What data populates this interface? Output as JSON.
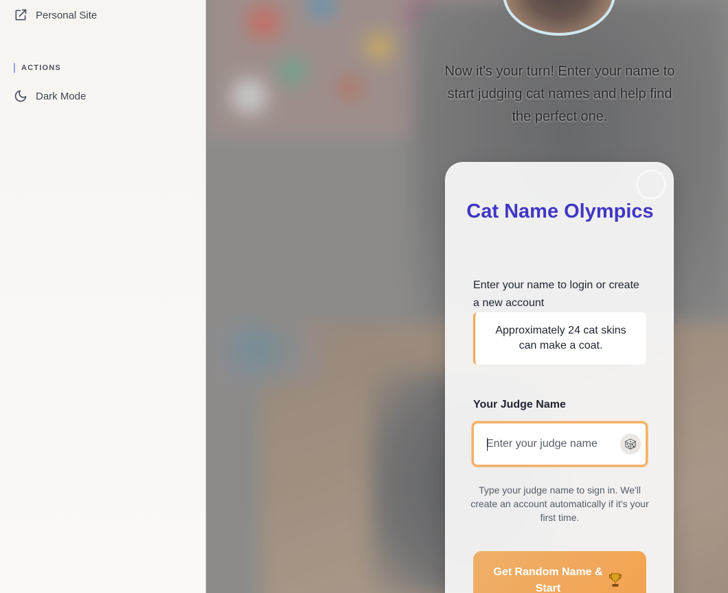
{
  "sidebar": {
    "personal_site": "Personal Site",
    "actions_heading": "ACTIONS",
    "dark_mode": "Dark Mode"
  },
  "main": {
    "intro_text": "Now it's your turn! Enter your name to start judging cat names and help find the perfect one."
  },
  "login_card": {
    "title": "Cat Name Olympics",
    "lead": "Enter your name to login or create a new account",
    "fact": "Approximately 24 cat skins can make a coat.",
    "field_label": "Your Judge Name",
    "input_placeholder": "Enter your judge name",
    "input_value": "",
    "hint": "Type your judge name to sign in. We'll create an account automatically if it's your first time.",
    "cta_label": "Get Random Name & Start"
  },
  "icons": {
    "personal_site": "external-link-icon",
    "dark_mode": "moon-icon",
    "random_name": "dice-icon",
    "cta": "trophy-icon"
  },
  "colors": {
    "title": "#4136c4",
    "accent_orange": "#f3a24f",
    "section_marker": "#8fa3e8"
  }
}
